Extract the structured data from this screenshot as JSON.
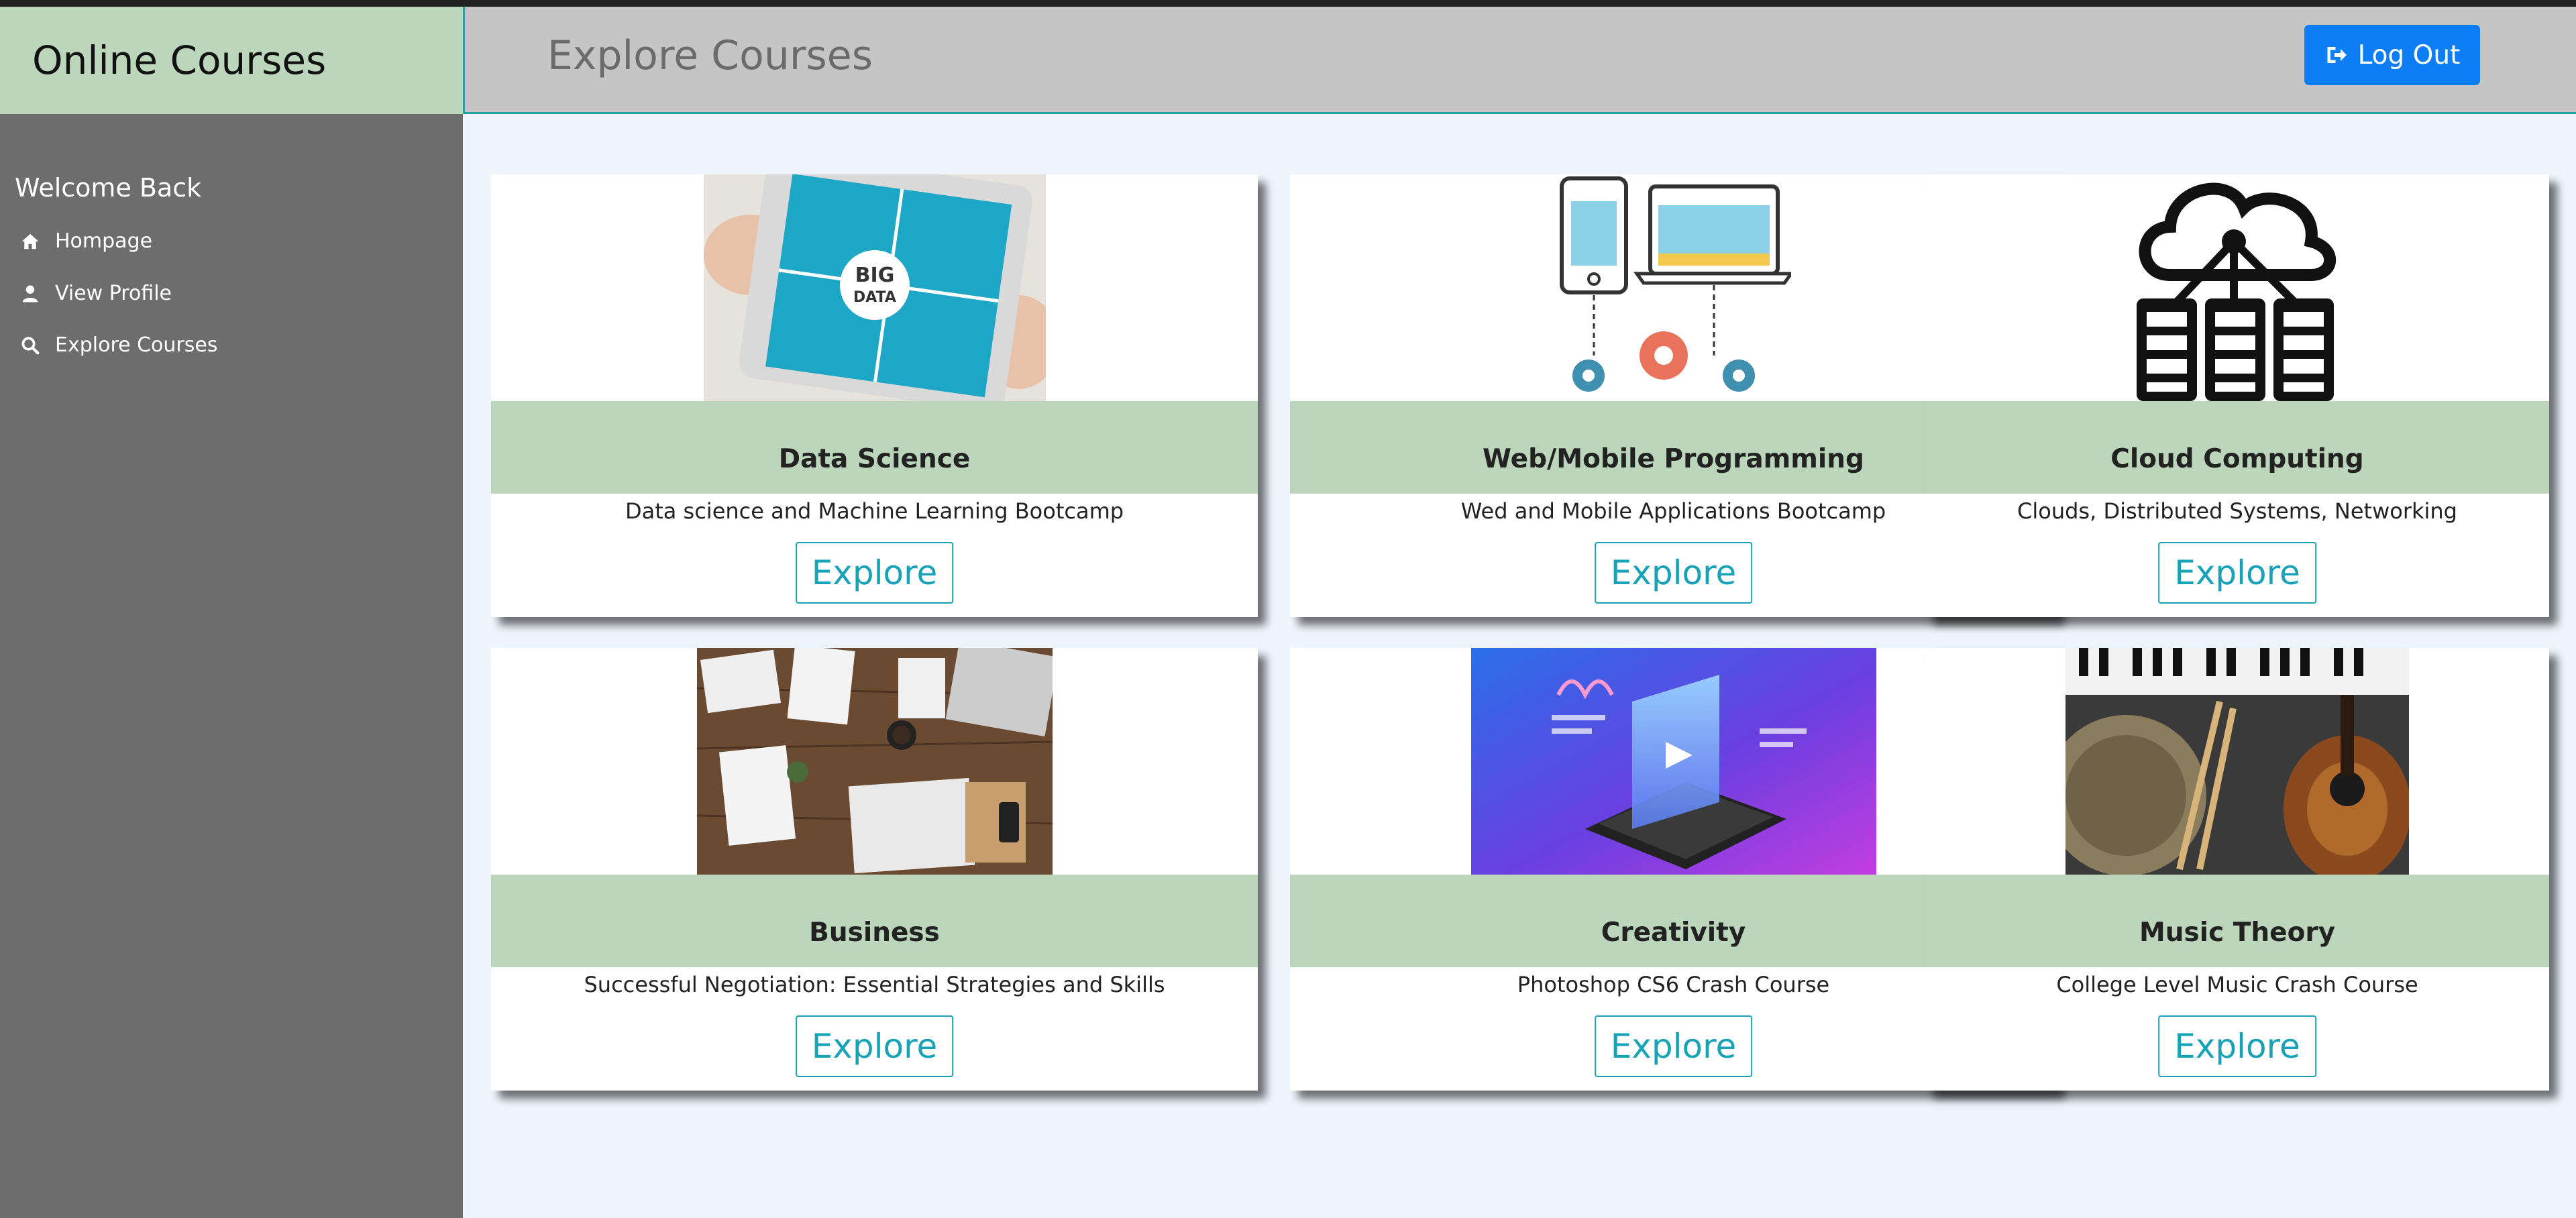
{
  "brand": {
    "title": "Online Courses"
  },
  "sidebar": {
    "welcome": "Welcome Back",
    "items": [
      {
        "label": "Hompage",
        "icon": "home-icon"
      },
      {
        "label": "View Profile",
        "icon": "user-icon"
      },
      {
        "label": "Explore Courses",
        "icon": "search-icon"
      }
    ]
  },
  "header": {
    "title": "Explore Courses",
    "logout_label": "Log Out",
    "logout_icon": "sign-out-icon"
  },
  "courses": [
    {
      "title": "Data Science",
      "description": "Data science and Machine Learning Bootcamp",
      "button": "Explore",
      "image": "big-data-tablet-image"
    },
    {
      "title": "Web/Mobile Programming",
      "description": "Wed and Mobile Applications Bootcamp",
      "button": "Explore",
      "image": "devices-gears-image"
    },
    {
      "title": "Cloud Computing",
      "description": "Clouds, Distributed Systems, Networking",
      "button": "Explore",
      "image": "cloud-servers-image"
    },
    {
      "title": "Business",
      "description": "Successful Negotiation: Essential Strategies and Skills",
      "button": "Explore",
      "image": "business-desk-image"
    },
    {
      "title": "Creativity",
      "description": "Photoshop CS6 Crash Course",
      "button": "Explore",
      "image": "isometric-phone-image"
    },
    {
      "title": "Music Theory",
      "description": "College Level Music Crash Course",
      "button": "Explore",
      "image": "instruments-image"
    }
  ],
  "colors": {
    "brand_green": "#bbd6bb",
    "sidebar": "#6d6d6d",
    "logout_blue": "#0d7ef5",
    "explore_teal": "#17a2b8"
  }
}
